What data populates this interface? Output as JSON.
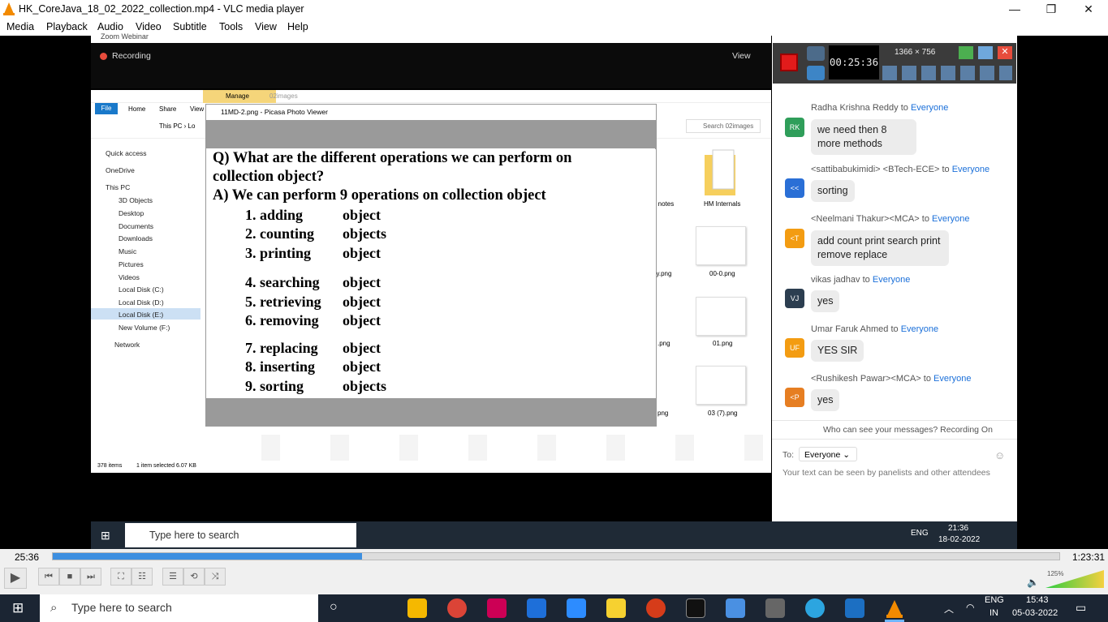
{
  "window": {
    "title": "HK_CoreJava_18_02_2022_collection.mp4 - VLC media player",
    "minimize": "—",
    "maximize": "❐",
    "close": "✕"
  },
  "menu": [
    "Media",
    "Playback",
    "Audio",
    "Video",
    "Subtitle",
    "Tools",
    "View",
    "Help"
  ],
  "zoom": {
    "top_label": "Zoom Webinar",
    "recording": "Recording",
    "view": "View"
  },
  "explorer": {
    "ribbon_tabs": [
      "File",
      "Home",
      "Share",
      "View"
    ],
    "manage_tab": "Manage",
    "manage_sub": "02images",
    "address": "This PC › Lo",
    "search_placeholder": "Search 02images",
    "sidebar": [
      "Quick access",
      "OneDrive",
      "This PC",
      "3D Objects",
      "Desktop",
      "Documents",
      "Downloads",
      "Music",
      "Pictures",
      "Videos",
      "Local Disk (C:)",
      "Local Disk (D:)",
      "Local Disk (E:)",
      "New Volume (F:)",
      "Network"
    ],
    "files_right": [
      "d notes",
      "HM Internals",
      "py.png",
      "00-0.png",
      ".png",
      "01.png",
      "png",
      "03 (7).png"
    ],
    "status": {
      "items": "378 items",
      "selected": "1 item selected  6.07 KB"
    }
  },
  "picasa": {
    "title": "11MD-2.png - Picasa Photo Viewer",
    "question_1": "Q) What are the different operations we can perform on",
    "question_2": "collection object?",
    "answer": "A) We can perform 9 operations on collection object",
    "items": [
      {
        "n": "1. adding",
        "o": "object"
      },
      {
        "n": "2. counting",
        "o": "objects"
      },
      {
        "n": "3. printing",
        "o": "object"
      },
      {
        "n": "4. searching",
        "o": "object"
      },
      {
        "n": "5. retrieving",
        "o": "object"
      },
      {
        "n": "6. removing",
        "o": "object"
      },
      {
        "n": "7. replacing",
        "o": "object"
      },
      {
        "n": "8. inserting",
        "o": "object"
      },
      {
        "n": "9. sorting",
        "o": "objects"
      }
    ]
  },
  "recorder": {
    "time": "00:25:36",
    "resolution": "1366 × 756"
  },
  "chat": {
    "messages": [
      {
        "from": "Radha Krishna Reddy",
        "to": "Everyone",
        "avatar": "RK",
        "color": "#2f9e5a",
        "text": "we need then 8 more methods"
      },
      {
        "from": "<sattibabukimidi> <BTech-ECE>",
        "to": "Everyone",
        "avatar": "<<",
        "color": "#2a6fd6",
        "text": "sorting"
      },
      {
        "from": "<Neelmani Thakur><MCA>",
        "to": "Everyone",
        "avatar": "<T",
        "color": "#f39c12",
        "text": "add count print search print remove replace"
      },
      {
        "from": "vikas jadhav",
        "to": "Everyone",
        "avatar": "VJ",
        "color": "#2c3e50",
        "text": "yes"
      },
      {
        "from": "Umar Faruk Ahmed",
        "to": "Everyone",
        "avatar": "UF",
        "color": "#f39c12",
        "text": "YES SIR"
      },
      {
        "from": "<Rushikesh Pawar><MCA>",
        "to": "Everyone",
        "avatar": "<P",
        "color": "#e67e22",
        "text": "yes"
      }
    ],
    "to_word": "to",
    "who_can_see": "Who can see your messages? Recording On",
    "to_label": "To:",
    "to_value": "Everyone",
    "placeholder": "Your text can be seen by panelists and other attendees"
  },
  "inner_taskbar": {
    "search": "Type here to search",
    "lang": "ENG",
    "time": "21:36",
    "date": "18-02-2022"
  },
  "player": {
    "current": "25:36",
    "total": "1:23:31",
    "progress": 0.307,
    "volume": "125%"
  },
  "os_taskbar": {
    "search": "Type here to search",
    "lang1": "ENG",
    "lang2": "IN",
    "time": "15:43",
    "date": "05-03-2022"
  }
}
